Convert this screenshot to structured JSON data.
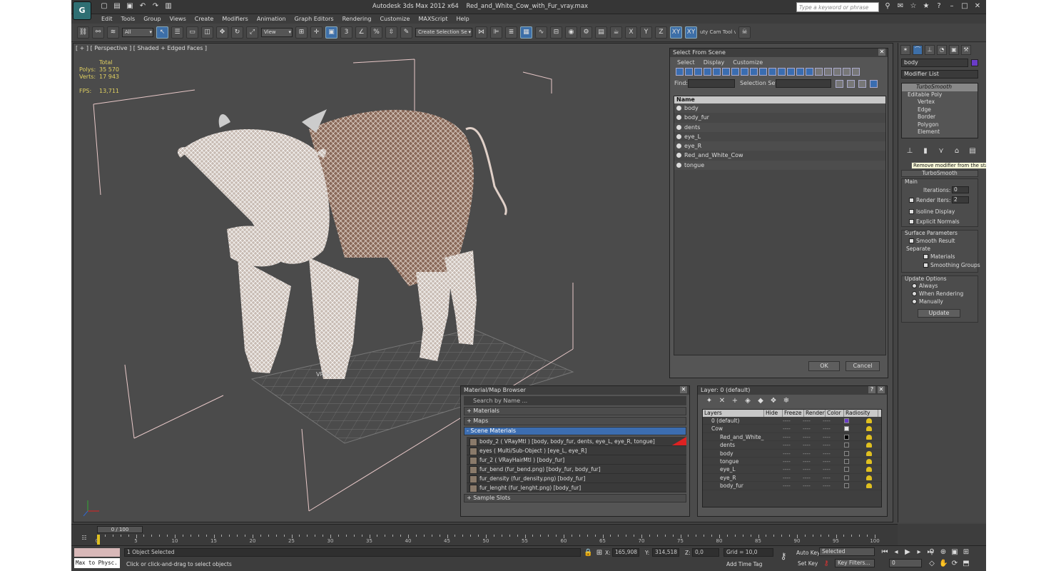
{
  "window": {
    "app_title": "Autodesk 3ds Max  2012 x64",
    "file_name": "Red_and_White_Cow_with_Fur_vray.max",
    "search_placeholder": "Type a keyword or phrase"
  },
  "menu": [
    "Edit",
    "Tools",
    "Group",
    "Views",
    "Create",
    "Modifiers",
    "Animation",
    "Graph Editors",
    "Rendering",
    "Customize",
    "MAXScript",
    "Help"
  ],
  "toolbar": {
    "filter_value": "All",
    "refcoord_value": "View",
    "selection_set_value": "Create Selection Se",
    "axis_x": "X",
    "axis_y": "Y",
    "axis_z": "Z",
    "axis_xy": "XY",
    "axis_xy2": "XY",
    "cam_tool": "uty Cam Tool v"
  },
  "viewport": {
    "label": "[ + ] [ Perspective ] [ Shaded + Edged Faces ]",
    "stats_total": "Total",
    "polys_label": "Polys:",
    "polys_value": "35 570",
    "verts_label": "Verts:",
    "verts_value": "17 943",
    "fps_label": "FPS:",
    "fps_value": "13,711",
    "vray_text": "VRay"
  },
  "select_from_scene": {
    "title": "Select From Scene",
    "menu": [
      "Select",
      "Display",
      "Customize"
    ],
    "find_label": "Find:",
    "selection_set_label": "Selection Set:",
    "column_name": "Name",
    "items": [
      "body",
      "body_fur",
      "dents",
      "eye_L",
      "eye_R",
      "Red_and_White_Cow",
      "tongue"
    ],
    "ok_label": "OK",
    "cancel_label": "Cancel"
  },
  "material_browser": {
    "title": "Material/Map Browser",
    "search_placeholder": "Search by Name ...",
    "rollout_materials": "+ Materials",
    "rollout_maps": "+ Maps",
    "rollout_scene": "- Scene Materials",
    "rollout_samples": "+ Sample Slots",
    "items": [
      "body_2  ( VRayMtl ) [body, body_fur, dents, eye_L, eye_R, tongue]",
      "eyes  ( Multi/Sub-Object ) [eye_L, eye_R]",
      "fur_2  ( VRayHairMtl ) [body_fur]",
      "fur_bend (fur_bend.png) [body_fur, body_fur]",
      "fur_density (fur_density.png) [body_fur]",
      "fur_lenght (fur_lenght.png) [body_fur]"
    ]
  },
  "layer_panel": {
    "title": "Layer: 0 (default)",
    "help": "?",
    "columns": [
      "Layers",
      "Hide",
      "Freeze",
      "Render",
      "Color",
      "Radiosity"
    ],
    "rows": [
      {
        "name": "0 (default)",
        "color": "#6a3cc8"
      },
      {
        "name": "Cow",
        "color": "#e8e8e8"
      },
      {
        "name": "Red_and_White_",
        "color": "#000000"
      },
      {
        "name": "dents",
        "color": "#3a3a3a"
      },
      {
        "name": "body",
        "color": "#3a3a3a"
      },
      {
        "name": "tongue",
        "color": "#3a3a3a"
      },
      {
        "name": "eye_L",
        "color": "#3a3a3a"
      },
      {
        "name": "eye_R",
        "color": "#3a3a3a"
      },
      {
        "name": "body_fur",
        "color": "#3a3a3a"
      }
    ]
  },
  "command_panel": {
    "object_name": "body",
    "modifier_list": "Modifier List",
    "stack": [
      "TurboSmooth",
      "Editable Poly",
      "Vertex",
      "Edge",
      "Border",
      "Polygon",
      "Element"
    ],
    "tooltip": "Remove modifier from the stack",
    "rollout_title": "TurboSmooth",
    "main_label": "Main",
    "iterations_label": "Iterations:",
    "iterations_value": "0",
    "render_iters_label": "Render Iters:",
    "render_iters_value": "2",
    "isoline_label": "Isoline Display",
    "explicit_label": "Explicit Normals",
    "surface_label": "Surface Parameters",
    "smooth_label": "Smooth Result",
    "separate_label": "Separate",
    "materials_label": "Materials",
    "smoothing_label": "Smoothing Groups",
    "update_options_label": "Update Options",
    "always_label": "Always",
    "when_rendering_label": "When Rendering",
    "manually_label": "Manually",
    "update_button": "Update"
  },
  "timeline": {
    "frame_display": "0 / 100",
    "ticks": [
      "0",
      "5",
      "10",
      "15",
      "20",
      "25",
      "30",
      "35",
      "40",
      "45",
      "50",
      "55",
      "60",
      "65",
      "70",
      "75",
      "80",
      "85",
      "90",
      "95",
      "100"
    ]
  },
  "status": {
    "maxscript_label": "Max to Physc.",
    "selected_text": "1 Object Selected",
    "prompt_text": "Click or click-and-drag to select objects",
    "x_label": "X:",
    "x_value": "165,908",
    "y_label": "Y:",
    "y_value": "314,518",
    "z_label": "Z:",
    "z_value": "0,0",
    "grid_text": "Grid = 10,0",
    "add_time_tag": "Add Time Tag",
    "auto_key": "Auto Key",
    "set_key": "Set Key",
    "key_dropdown": "Selected",
    "key_filters": "Key Filters...",
    "frame_value": "0"
  }
}
